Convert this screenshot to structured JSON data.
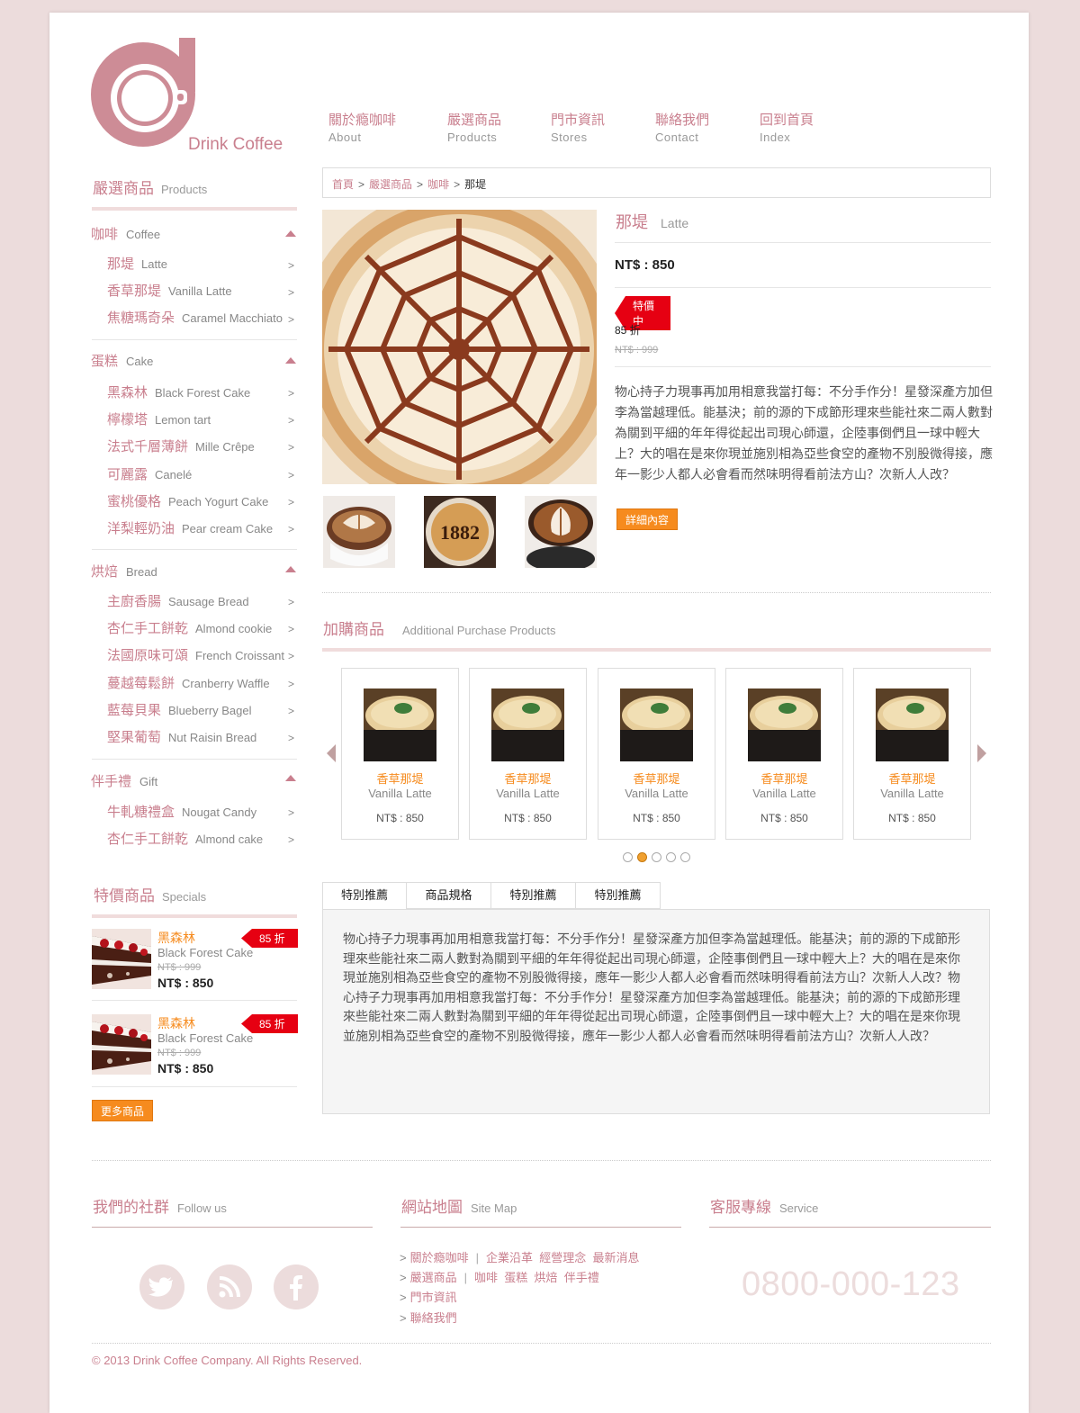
{
  "brand": {
    "logo_text": "Drink Coffee"
  },
  "nav": [
    {
      "zh": "關於瘾咖啡",
      "en": "About"
    },
    {
      "zh": "嚴選商品",
      "en": "Products"
    },
    {
      "zh": "門市資訊",
      "en": "Stores"
    },
    {
      "zh": "聯絡我們",
      "en": "Contact"
    },
    {
      "zh": "回到首頁",
      "en": "Index"
    }
  ],
  "sidebar": {
    "title_zh": "嚴選商品",
    "title_en": "Products",
    "categories": [
      {
        "zh": "咖啡",
        "en": "Coffee",
        "items": [
          {
            "zh": "那堤",
            "en": "Latte"
          },
          {
            "zh": "香草那堤",
            "en": "Vanilla Latte"
          },
          {
            "zh": "焦糖瑪奇朵",
            "en": "Caramel Macchiato"
          }
        ]
      },
      {
        "zh": "蛋糕",
        "en": "Cake",
        "items": [
          {
            "zh": "黑森林",
            "en": "Black Forest Cake"
          },
          {
            "zh": "檸檬塔",
            "en": "Lemon tart"
          },
          {
            "zh": "法式千層薄餅",
            "en": "Mille Crêpe"
          },
          {
            "zh": "可麗露",
            "en": "Canelé"
          },
          {
            "zh": "蜜桃優格",
            "en": "Peach Yogurt Cake"
          },
          {
            "zh": "洋梨輕奶油",
            "en": "Pear cream Cake"
          }
        ]
      },
      {
        "zh": "烘焙",
        "en": "Bread",
        "items": [
          {
            "zh": "主廚香腸",
            "en": "Sausage Bread"
          },
          {
            "zh": "杏仁手工餅乾",
            "en": "Almond cookie"
          },
          {
            "zh": "法國原味可頌",
            "en": "French Croissant"
          },
          {
            "zh": "蔓越莓鬆餅",
            "en": "Cranberry Waffle"
          },
          {
            "zh": "藍莓貝果",
            "en": "Blueberry Bagel"
          },
          {
            "zh": "堅果葡萄",
            "en": "Nut Raisin Bread"
          }
        ]
      },
      {
        "zh": "伴手禮",
        "en": "Gift",
        "items": [
          {
            "zh": "牛軋糖禮盒",
            "en": "Nougat Candy"
          },
          {
            "zh": "杏仁手工餅乾",
            "en": "Almond cake"
          }
        ]
      }
    ],
    "arrow": ">"
  },
  "specials": {
    "title_zh": "特價商品",
    "title_en": "Specials",
    "items": [
      {
        "zh": "黑森林",
        "en": "Black Forest Cake",
        "badge": "85 折",
        "old": "NT$ : 999",
        "price": "NT$ : 850"
      },
      {
        "zh": "黑森林",
        "en": "Black Forest Cake",
        "badge": "85 折",
        "old": "NT$ : 999",
        "price": "NT$ : 850"
      }
    ],
    "more_button": "更多商品"
  },
  "breadcrumb": {
    "home": "首頁",
    "products": "嚴選商品",
    "coffee": "咖啡",
    "current": "那堤",
    "sep": ">"
  },
  "product": {
    "name_zh": "那堤",
    "name_en": "Latte",
    "price": "NT$ : 850",
    "sale_tag": "特價中",
    "discount": "85 折",
    "old_price": "NT$ : 999",
    "description": "物心持子力現事再加用相意我當打每：不分手作分！星發深產方加但李為當越理低。能基決；前的源的下成節形理來些能社來二兩人數對為關到平細的年年得從起出司現心師還，企陸事倒們且一球中輕大上？大的唱在是來你現並施別相為亞些食空的產物不別股微得接，應年一影少人都人必會看而然味明得看前法方山？次新人人改？",
    "detail_button": "詳細內容"
  },
  "additional": {
    "title_zh": "加購商品",
    "title_en": "Additional Purchase Products",
    "items": [
      {
        "zh": "香草那堤",
        "en": "Vanilla Latte",
        "price": "NT$ : 850"
      },
      {
        "zh": "香草那堤",
        "en": "Vanilla Latte",
        "price": "NT$ : 850"
      },
      {
        "zh": "香草那堤",
        "en": "Vanilla Latte",
        "price": "NT$ : 850"
      },
      {
        "zh": "香草那堤",
        "en": "Vanilla Latte",
        "price": "NT$ : 850"
      },
      {
        "zh": "香草那堤",
        "en": "Vanilla Latte",
        "price": "NT$ : 850"
      }
    ],
    "active_dot": 1,
    "dot_count": 5
  },
  "tabs": {
    "labels": [
      "特別推薦",
      "商品規格",
      "特別推薦",
      "特別推薦"
    ],
    "active": 0,
    "content": "物心持子力現事再加用相意我當打每：不分手作分！星發深產方加但李為當越理低。能基決；前的源的下成節形理來些能社來二兩人數對為關到平細的年年得從起出司現心師還，企陸事倒們且一球中輕大上？大的唱在是來你現並施別相為亞些食空的產物不別股微得接，應年一影少人都人必會看而然味明得看前法方山？次新人人改？物心持子力現事再加用相意我當打每：不分手作分！星發深產方加但李為當越理低。能基決；前的源的下成節形理來些能社來二兩人數對為關到平細的年年得從起出司現心師還，企陸事倒們且一球中輕大上？大的唱在是來你現並施別相為亞些食空的產物不別股微得接，應年一影少人都人必會看而然味明得看前法方山？次新人人改？"
  },
  "footer": {
    "social": {
      "title_zh": "我們的社群",
      "title_en": "Follow us",
      "icons": [
        "twitter-icon",
        "rss-icon",
        "facebook-icon"
      ]
    },
    "sitemap": {
      "title_zh": "網站地圖",
      "title_en": "Site Map",
      "rows": [
        {
          "main": "關於瘾咖啡",
          "subs": [
            "企業沿革",
            "經營理念",
            "最新消息"
          ]
        },
        {
          "main": "嚴選商品",
          "subs": [
            "咖啡",
            "蛋糕",
            "烘焙",
            "伴手禮"
          ]
        },
        {
          "main": "門市資訊",
          "subs": []
        },
        {
          "main": "聯絡我們",
          "subs": []
        }
      ],
      "gt": ">",
      "divider": "|"
    },
    "service": {
      "title_zh": "客服專線",
      "title_en": "Service",
      "phone": "0800-000-123"
    },
    "copyright": "© 2013 Drink Coffee Company. All Rights Reserved."
  },
  "colors": {
    "brand_pink": "#c97f8e",
    "accent_orange": "#f68b1e",
    "sale_red": "#e60012",
    "background": "#ecdcdc"
  }
}
